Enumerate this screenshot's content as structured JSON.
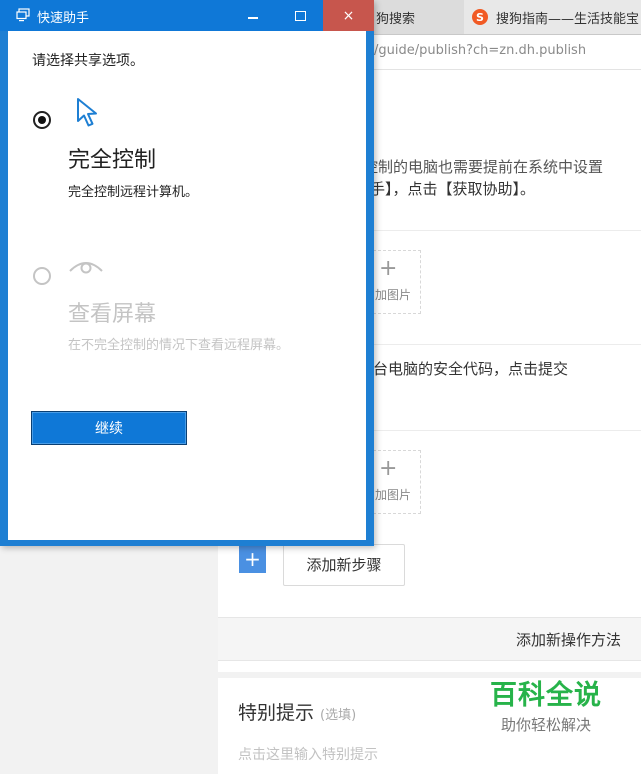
{
  "browser": {
    "tabs": [
      {
        "label": "狗搜索"
      },
      {
        "label": "搜狗指南——生活技能宝",
        "icon": "sogou-logo-icon",
        "icon_text": "S"
      }
    ],
    "address": "/guide/publish?ch=zn.dh.publish"
  },
  "editor": {
    "step1_line_a": "被控制的电脑也需要提前在系统中设置",
    "step1_line_b": "手】，点击【获取协助】。",
    "add_image": {
      "plus": "+",
      "label": "加图片"
    },
    "step2_text": "台电脑的安全代码，点击提交",
    "add_step_plus": "+",
    "add_step_label": "添加新步骤",
    "add_method_label": "添加新操作方法",
    "tips": {
      "title": "特别提示",
      "optional": "(选填)",
      "placeholder": "点击这里输入特别提示"
    }
  },
  "watermark": {
    "line1": "百科全说",
    "line2": "助你轻松解决"
  },
  "dialog": {
    "title": "快速助手",
    "prompt": "请选择共享选项。",
    "options": [
      {
        "title": "完全控制",
        "desc": "完全控制远程计算机。",
        "icon": "cursor-arrow-icon",
        "selected": true
      },
      {
        "title": "查看屏幕",
        "desc": "在不完全控制的情况下查看远程屏幕。",
        "icon": "eye-icon",
        "selected": false
      }
    ],
    "continue_label": "继续",
    "buttons": {
      "minimize": "minimize-icon",
      "maximize": "maximize-icon",
      "close": "×"
    }
  },
  "colors": {
    "titlebar": "#0f78d7",
    "close_button": "#c7564d",
    "watermark_green": "#27b34a",
    "add_step_blue": "#4a90e2"
  }
}
